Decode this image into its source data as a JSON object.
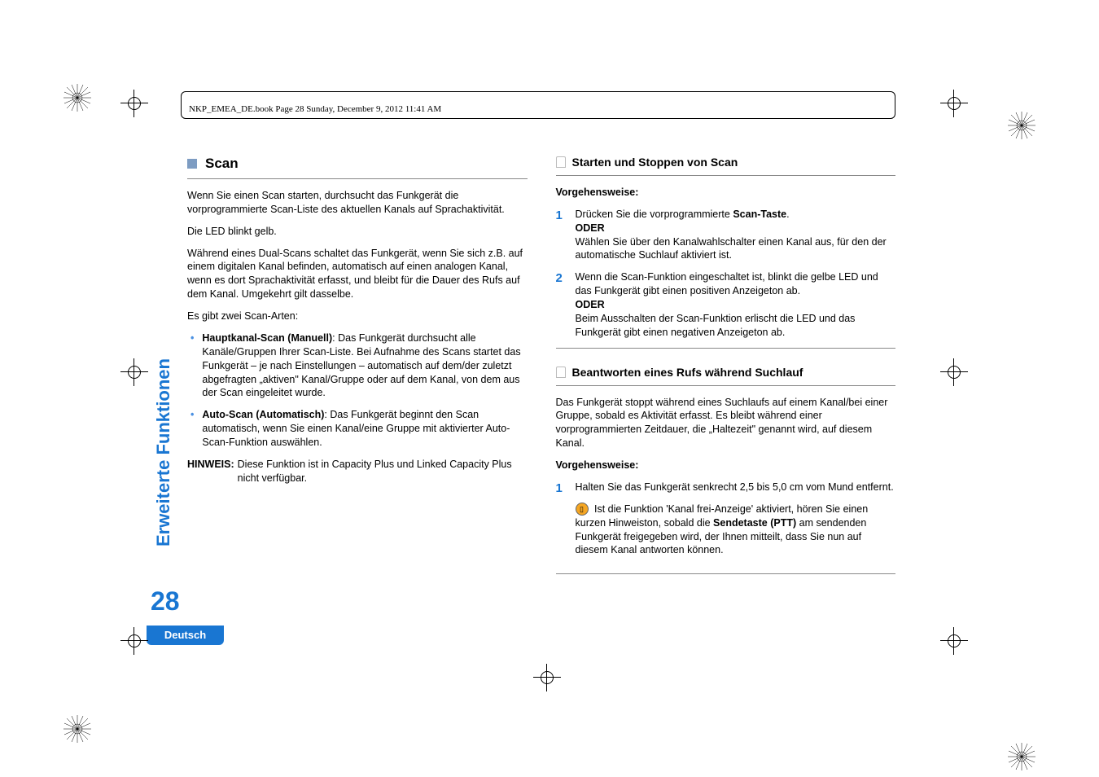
{
  "header_info": "NKP_EMEA_DE.book  Page 28  Sunday, December 9, 2012  11:41 AM",
  "side_label": "Erweiterte Funktionen",
  "page_number": "28",
  "language_tab": "Deutsch",
  "left": {
    "section_title": "Scan",
    "p1": "Wenn Sie einen Scan starten, durchsucht das Funkgerät die vorprogrammierte Scan-Liste des aktuellen Kanals auf Sprachaktivität.",
    "p2": "Die LED blinkt gelb.",
    "p3": "Während eines Dual-Scans schaltet das Funkgerät, wenn Sie sich z.B. auf einem digitalen Kanal befinden, automatisch auf einen analogen Kanal, wenn es dort Sprachaktivität erfasst, und bleibt für die Dauer des Rufs auf dem Kanal. Umgekehrt gilt dasselbe.",
    "p4": "Es gibt zwei Scan-Arten:",
    "bullet1_bold": "Hauptkanal-Scan (Manuell)",
    "bullet1_rest": ": Das Funkgerät durchsucht alle Kanäle/Gruppen Ihrer Scan-Liste. Bei Aufnahme des Scans startet das Funkgerät – je nach Einstellungen – automatisch auf dem/der zuletzt abgefragten „aktiven\" Kanal/Gruppe oder auf dem Kanal, von dem aus der Scan eingeleitet wurde.",
    "bullet2_bold": "Auto-Scan (Automatisch)",
    "bullet2_rest": ": Das Funkgerät beginnt den Scan automatisch, wenn Sie einen Kanal/eine Gruppe mit aktivierter Auto-Scan-Funktion auswählen.",
    "hinweis_label": "HINWEIS:",
    "hinweis_body": "Diese Funktion ist in Capacity Plus und Linked Capacity Plus nicht verfügbar."
  },
  "right": {
    "sub1_title": "Starten und Stoppen von Scan",
    "vorg": "Vorgehensweise:",
    "step1_a": "Drücken Sie die vorprogrammierte ",
    "step1_b_bold": "Scan-Taste",
    "step1_c": ".",
    "oder": "ODER",
    "step1_d": "Wählen Sie über den Kanalwahlschalter einen Kanal aus, für den der automatische Suchlauf aktiviert ist.",
    "step2_a": "Wenn die Scan-Funktion eingeschaltet ist, blinkt die gelbe LED und das Funkgerät gibt einen positiven Anzeigeton ab.",
    "step2_b": "Beim Ausschalten der Scan-Funktion erlischt die LED und das Funkgerät gibt einen negativen Anzeigeton ab.",
    "sub2_title": "Beantworten eines Rufs während Suchlauf",
    "sub2_p1": "Das Funkgerät stoppt während eines Suchlaufs auf einem Kanal/bei einer Gruppe, sobald es Aktivität erfasst. Es bleibt während einer vorprogrammierten Zeitdauer, die „Haltezeit\" genannt wird, auf diesem Kanal.",
    "sub2_step1": "Halten Sie das Funkgerät senkrecht 2,5 bis 5,0 cm vom Mund entfernt.",
    "sub2_note_a": " Ist die Funktion 'Kanal frei-Anzeige' aktiviert, hören Sie einen kurzen Hinweiston, sobald die ",
    "sub2_note_bold": "Sendetaste (PTT)",
    "sub2_note_b": " am sendenden Funkgerät freigegeben wird, der Ihnen mitteilt, dass Sie nun auf diesem Kanal antworten können."
  }
}
